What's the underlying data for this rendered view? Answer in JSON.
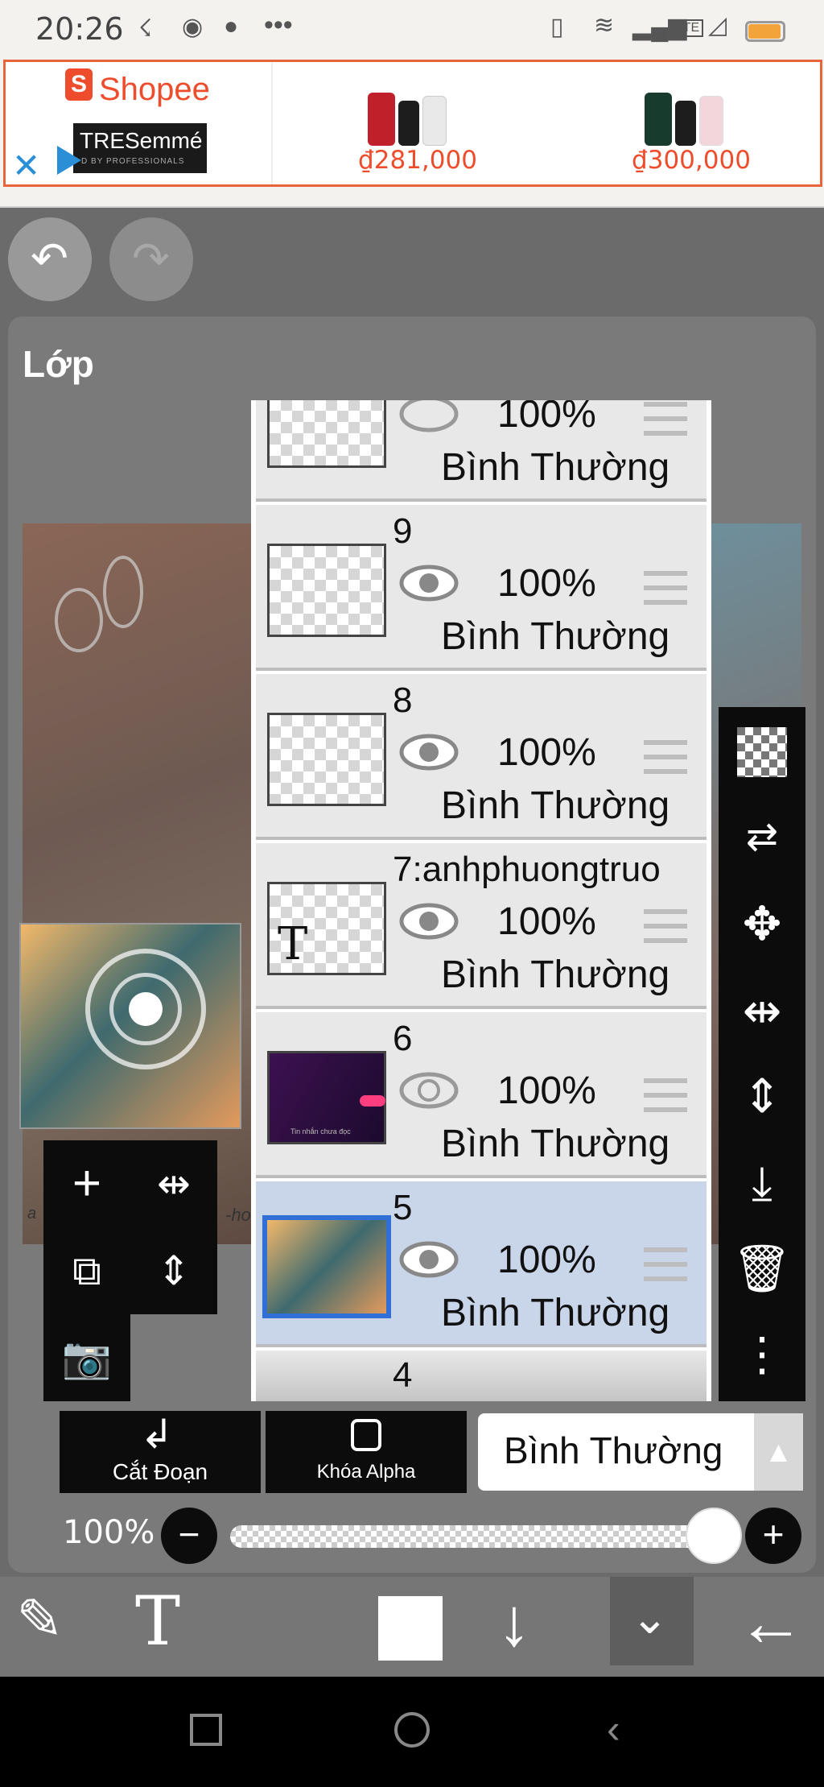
{
  "status_bar": {
    "time": "20:26",
    "network": "LTE",
    "icons": [
      "missed-call-icon",
      "messenger-icon",
      "chat-bubble-icon",
      "more-dots-icon",
      "vibrate-icon",
      "wifi-icon",
      "signal-icon",
      "volte-icon",
      "battery-icon"
    ]
  },
  "ad": {
    "brand": "Shopee",
    "product_brand": "TRESemmé",
    "product_tagline": "D BY PROFESSIONALS",
    "items": [
      {
        "price": "₫281,000"
      },
      {
        "price": "₫300,000"
      }
    ],
    "accent": "#ee4d2d"
  },
  "panel": {
    "title": "Lớp"
  },
  "layers": [
    {
      "name": "",
      "opacity": "100%",
      "mode": "Bình Thường",
      "selected": false
    },
    {
      "name": "9",
      "opacity": "100%",
      "mode": "Bình Thường",
      "selected": false
    },
    {
      "name": "8",
      "opacity": "100%",
      "mode": "Bình Thường",
      "selected": false
    },
    {
      "name": "7:anhphuongtruo",
      "opacity": "100%",
      "mode": "Bình Thường",
      "selected": false,
      "thumb_text": "T"
    },
    {
      "name": "6",
      "opacity": "100%",
      "mode": "Bình Thường",
      "selected": false,
      "thumb_text": "Tin nhắn chưa đọc"
    },
    {
      "name": "5",
      "opacity": "100%",
      "mode": "Bình Thường",
      "selected": true
    },
    {
      "name": "4"
    }
  ],
  "bottom_controls": {
    "clip_label": "Cắt Đoạn",
    "alpha_lock_label": "Khóa Alpha",
    "blend_mode": "Bình Thường",
    "opacity_label": "100%",
    "opacity_value": 1.0
  },
  "canvas_text": {
    "left_caption": "a",
    "right_caption": "-ho"
  },
  "colors": {
    "selected_layer": "#c9d6ea",
    "selected_border": "#2f6fd6"
  }
}
